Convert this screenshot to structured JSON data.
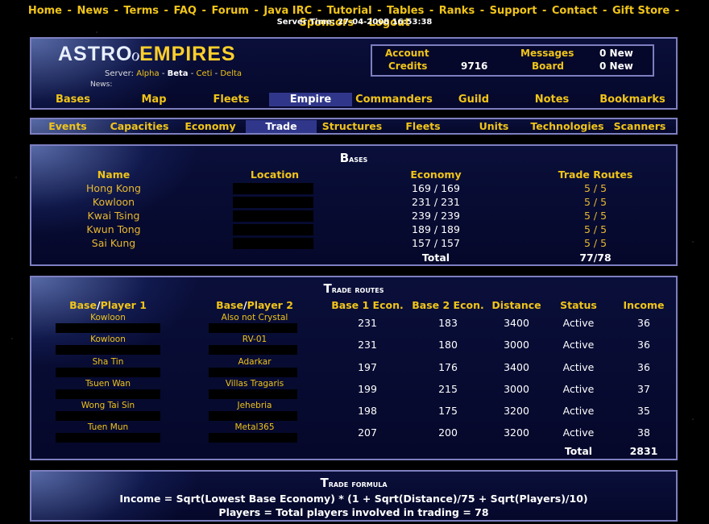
{
  "topnav": [
    "Home",
    "News",
    "Terms",
    "FAQ",
    "Forum",
    "Java IRC",
    "Tutorial",
    "Tables",
    "Ranks",
    "Support",
    "Contact",
    "Gift Store",
    "Sponsors",
    "Logout"
  ],
  "server_time": "Server Time: 27-04-2008 16:53:38",
  "logo": {
    "part1": "ASTRO",
    "part2": "EMPIRES"
  },
  "server": {
    "label": "Server:",
    "alpha": "Alpha",
    "beta": "Beta",
    "ceti": "Ceti",
    "delta": "Delta",
    "dash": "-"
  },
  "news_label": "News:",
  "account": {
    "account_label": "Account",
    "credits_label": "Credits",
    "credits_value": "9716",
    "messages_label": "Messages",
    "messages_value": "0 New",
    "board_label": "Board",
    "board_value": "0 New"
  },
  "mainmenu": [
    "Bases",
    "Map",
    "Fleets",
    "Empire",
    "Commanders",
    "Guild",
    "Notes",
    "Bookmarks"
  ],
  "submenu": [
    "Events",
    "Capacities",
    "Economy",
    "Trade",
    "Structures",
    "Fleets",
    "Units",
    "Technologies",
    "Scanners"
  ],
  "bases_panel": {
    "title_first": "B",
    "title_rest": "ases",
    "headers": [
      "Name",
      "Location",
      "Economy",
      "Trade Routes"
    ],
    "rows": [
      {
        "name": "Hong Kong",
        "economy": "169 / 169",
        "routes": "5 / 5"
      },
      {
        "name": "Kowloon",
        "economy": "231 / 231",
        "routes": "5 / 5"
      },
      {
        "name": "Kwai Tsing",
        "economy": "239 / 239",
        "routes": "5 / 5"
      },
      {
        "name": "Kwun Tong",
        "economy": "189 / 189",
        "routes": "5 / 5"
      },
      {
        "name": "Sai Kung",
        "economy": "157 / 157",
        "routes": "5 / 5"
      }
    ],
    "total_label": "Total",
    "total_value": "77/78"
  },
  "routes_panel": {
    "title_first": "T",
    "title_rest": "rade routes",
    "headers": {
      "base1_a": "Base",
      "slash": "/",
      "base1_b": "Player 1",
      "base2_a": "Base",
      "base2_b": "Player 2",
      "econ1": "Base 1 Econ.",
      "econ2": "Base 2 Econ.",
      "distance": "Distance",
      "status": "Status",
      "income": "Income"
    },
    "rows": [
      {
        "b1": "Kowloon",
        "b2": "Also not Crystal",
        "e1": "231",
        "e2": "183",
        "dist": "3400",
        "status": "Active",
        "income": "36"
      },
      {
        "b1": "Kowloon",
        "b2": "RV-01",
        "e1": "231",
        "e2": "180",
        "dist": "3000",
        "status": "Active",
        "income": "36"
      },
      {
        "b1": "Sha Tin",
        "b2": "Adarkar",
        "e1": "197",
        "e2": "176",
        "dist": "3400",
        "status": "Active",
        "income": "36"
      },
      {
        "b1": "Tsuen Wan",
        "b2": "Villas Tragaris",
        "e1": "199",
        "e2": "215",
        "dist": "3000",
        "status": "Active",
        "income": "37"
      },
      {
        "b1": "Wong Tai Sin",
        "b2": "Jehebria",
        "e1": "198",
        "e2": "175",
        "dist": "3200",
        "status": "Active",
        "income": "35"
      },
      {
        "b1": "Tuen Mun",
        "b2": "Metal365",
        "e1": "207",
        "e2": "200",
        "dist": "3200",
        "status": "Active",
        "income": "38"
      }
    ],
    "total_label": "Total",
    "total_value": "2831"
  },
  "formula_panel": {
    "title_first": "T",
    "title_rest": "rade formula",
    "line1": "Income = Sqrt(Lowest Base Economy) * (1 + Sqrt(Distance)/75 + Sqrt(Players)/10)",
    "line2": "Players = Total players involved in trading = 78"
  }
}
